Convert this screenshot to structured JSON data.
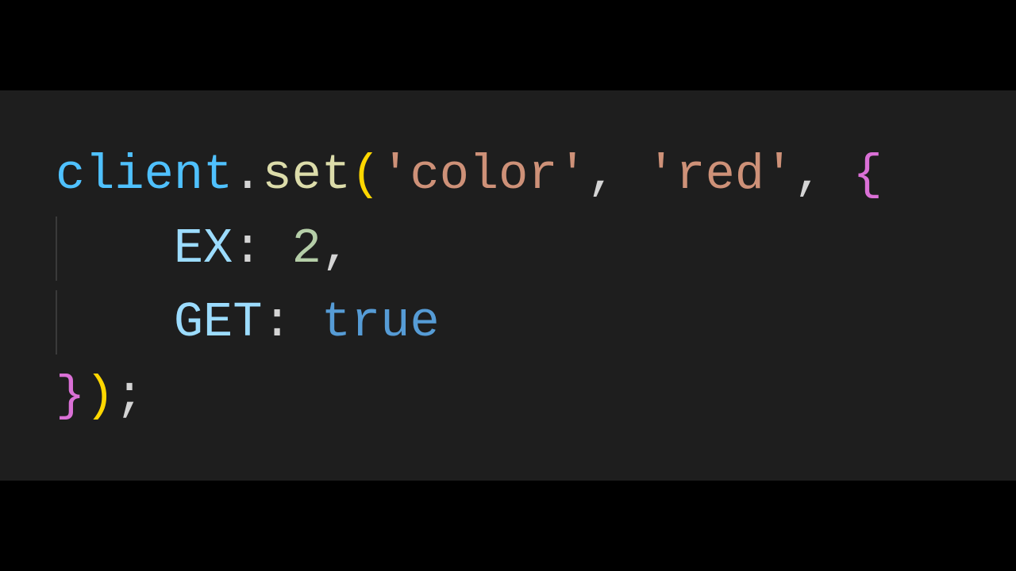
{
  "code": {
    "line1": {
      "variable": "client",
      "dot": ".",
      "method": "set",
      "openParen": "(",
      "string1": "'color'",
      "comma1": ", ",
      "string2": "'red'",
      "comma2": ", ",
      "openBrace": "{"
    },
    "line2": {
      "indent": "    ",
      "property": "EX",
      "colon": ": ",
      "value": "2",
      "comma": ","
    },
    "line3": {
      "indent": "    ",
      "property": "GET",
      "colon": ": ",
      "value": "true"
    },
    "line4": {
      "closeBrace": "}",
      "closeParen": ")",
      "semicolon": ";"
    }
  },
  "colors": {
    "background": "#1e1e1e",
    "letterbox": "#000000",
    "variable": "#4fc1ff",
    "default": "#d4d4d4",
    "method": "#dcdcaa",
    "paren": "#ffd700",
    "string": "#ce9178",
    "brace": "#da70d6",
    "property": "#9cdcfe",
    "number": "#b5cea8",
    "keyword": "#569cd6"
  }
}
